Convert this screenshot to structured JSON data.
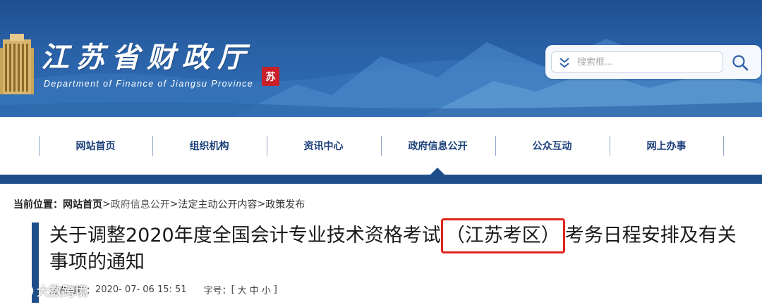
{
  "header": {
    "title": "江苏省财政厅",
    "subtitle": "Department of Finance of Jiangsu Province",
    "seal_text": "苏",
    "search": {
      "placeholder": "搜索框..."
    }
  },
  "nav": {
    "items": [
      {
        "label": "网站首页"
      },
      {
        "label": "组织机构"
      },
      {
        "label": "资讯中心"
      },
      {
        "label": "政府信息公开"
      },
      {
        "label": "公众互动"
      },
      {
        "label": "网上办事"
      }
    ],
    "active_index": 3
  },
  "breadcrumb": {
    "label": "当前位置：",
    "home": "网站首页",
    "items": [
      "政府信息公开",
      "法定主动公开内容",
      "政策发布"
    ],
    "separator": ">"
  },
  "article": {
    "title_before": "关于调整2020年度全国会计专业技术资格考试",
    "title_highlight": "（江苏考区）",
    "title_after": "考务日程安排及有关事项的通知",
    "publish_label": "发布日期：",
    "publish_date": "2020- 07- 06  15: 51",
    "fontsize_label": "字号：",
    "fontsize_open": "[",
    "fontsize_options": [
      "大",
      "中",
      "小"
    ],
    "fontsize_close": "]"
  },
  "watermark": {
    "text": "大数跨境"
  },
  "colors": {
    "banner": "#2a62a8",
    "nav_bar": "#1e4e89",
    "nav_text": "#1b3f7a",
    "highlight_box": "#e0241a",
    "seal": "#c9202a"
  }
}
